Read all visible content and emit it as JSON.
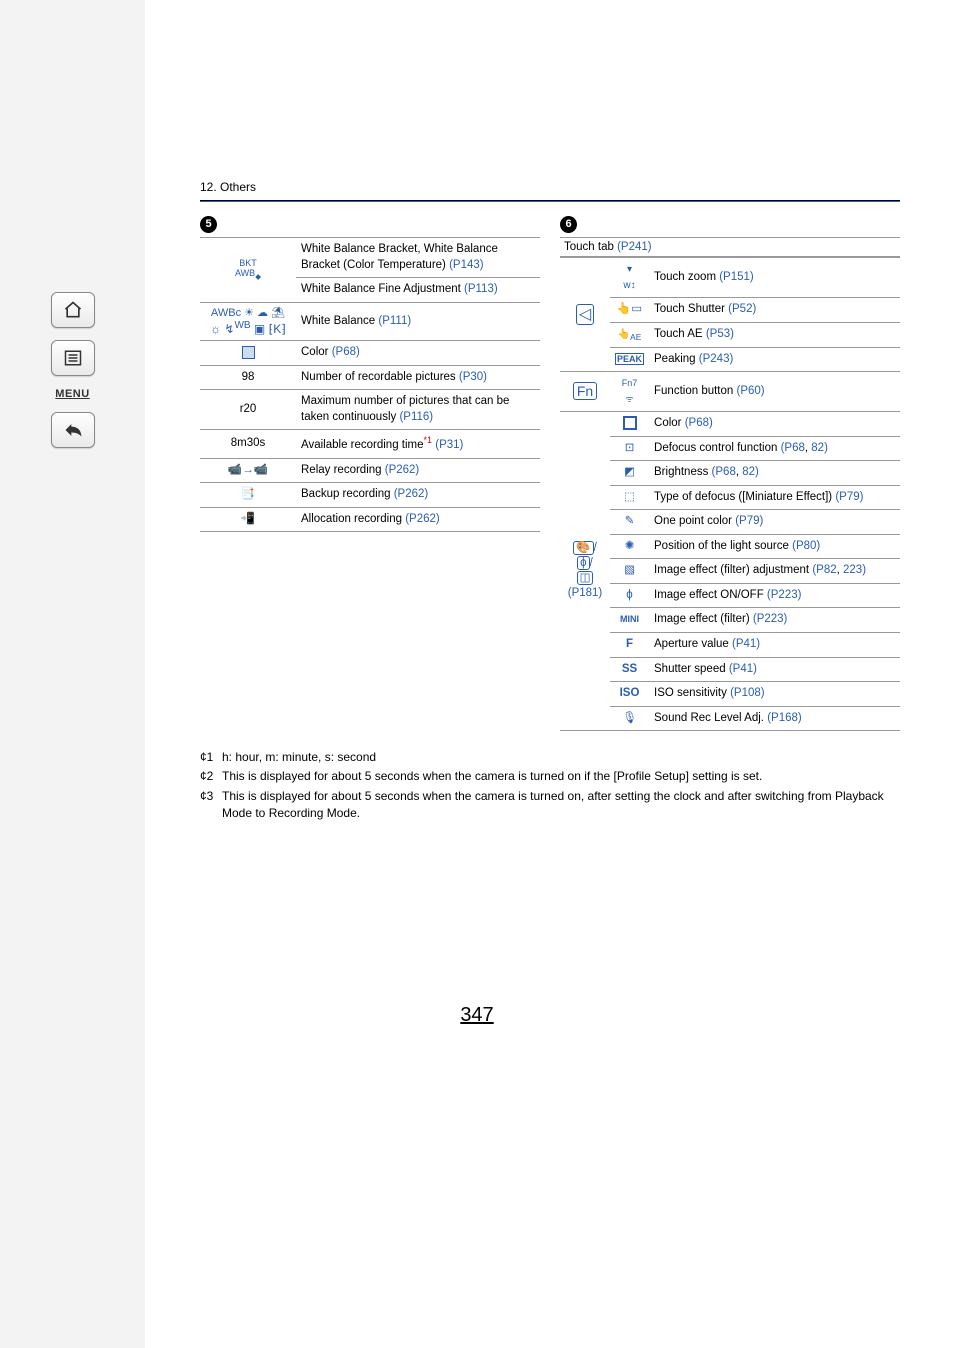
{
  "breadcrumb": "12. Others",
  "section5": {
    "badge": "5",
    "rows": [
      {
        "icon_html": "<div class='bkt'>BKT</div><div class='bkt'>AWB<sub>◆</sub></div>",
        "desc": "White Balance Bracket, White Balance Bracket (Color Temperature) ",
        "ref": "(P143)"
      },
      {
        "icon_html": "",
        "rowspan_from_prev": true,
        "desc": "White Balance Fine Adjustment ",
        "ref": "(P113)"
      },
      {
        "icon_html": "<div class='awb-line1'>AWBc ☼☁⛅</div><div class='awb-line2'>-☼- ‣<sup>WB</sup> ▣ ⁅K⁆</div>",
        "desc": "White Balance ",
        "ref": "(P111)"
      },
      {
        "icon_html": "<span class='square'></span>",
        "desc": "Color ",
        "ref": "(P68)"
      },
      {
        "icon_text": "98",
        "desc": "Number of recordable pictures ",
        "ref": "(P30)"
      },
      {
        "icon_text": "r20",
        "desc": "Maximum number of pictures that can be taken continuously ",
        "ref": "(P116)"
      },
      {
        "icon_text": "8m30s",
        "desc": "Available recording time",
        "sup": "*1",
        "ref": " (P31)"
      },
      {
        "icon_html": "<span class='iconrow'>📹 📹</span>",
        "desc": "Relay recording ",
        "ref": "(P262)"
      },
      {
        "icon_html": "<span style='color:#2a5db0'>📑</span>",
        "desc": "Backup recording ",
        "ref": "(P262)"
      },
      {
        "icon_html": "<span style='color:#2a5db0'>📲</span>",
        "desc": "Allocation recording ",
        "ref": "(P262)"
      }
    ]
  },
  "section6": {
    "badge": "6",
    "touch_tab_label": "Touch tab ",
    "touch_tab_ref": "(P241)",
    "p181_ref": "(P181)",
    "group1_icon": "◁",
    "group2_icon": "⟐",
    "group3_icons": "🎥/\n⏺/\n◫",
    "rows_g1": [
      {
        "icon": "⤢",
        "icon_name": "touch-zoom-icon",
        "desc": "Touch zoom ",
        "ref": "(P151)"
      },
      {
        "icon": "👆▭",
        "icon_name": "touch-shutter-icon",
        "desc": "Touch Shutter ",
        "ref": "(P52)"
      },
      {
        "icon": "👆AE",
        "icon_name": "touch-ae-icon",
        "desc": "Touch AE ",
        "ref": "(P53)"
      },
      {
        "icon": "PEAK",
        "icon_name": "peaking-icon",
        "desc": "Peaking ",
        "ref": "(P243)"
      }
    ],
    "rows_g2": [
      {
        "icon": "Fn7\nᯤ",
        "icon_name": "fn7-icon",
        "desc": "Function button ",
        "ref": "(P60)"
      }
    ],
    "rows_g3": [
      {
        "icon": "▣",
        "icon_name": "color-icon",
        "desc": "Color ",
        "ref": "(P68)"
      },
      {
        "icon": "⊡",
        "icon_name": "defocus-icon",
        "desc": "Defocus control function ",
        "ref": "(P68",
        "ref2": "82)"
      },
      {
        "icon": "⧉",
        "icon_name": "brightness-icon",
        "desc": "Brightness ",
        "ref": "(P68",
        "ref2": "82)"
      },
      {
        "icon": "⬚",
        "icon_name": "miniature-defocus-icon",
        "desc": "Type of defocus ([Miniature Effect]) ",
        "ref": "(P79)"
      },
      {
        "icon": "✎",
        "icon_name": "one-point-color-icon",
        "desc": "One point color ",
        "ref": "(P79)"
      },
      {
        "icon": "✺",
        "icon_name": "light-source-icon",
        "desc": "Position of the light source ",
        "ref": "(P80)"
      },
      {
        "icon": "▧",
        "icon_name": "filter-adjust-icon",
        "desc": "Image effect (filter) adjustment ",
        "ref": "(P82",
        "ref2": "223)"
      },
      {
        "icon": "ϕ",
        "icon_name": "effect-onoff-icon",
        "desc": "Image effect ON/OFF ",
        "ref": "(P223)"
      },
      {
        "icon": "MINI",
        "icon_name": "mini-icon",
        "is_mini": true,
        "desc": "Image effect (filter) ",
        "ref": "(P223)"
      },
      {
        "icon": "F",
        "icon_name": "aperture-icon",
        "desc": "Aperture value ",
        "ref": "(P41)"
      },
      {
        "icon": "SS",
        "icon_name": "shutter-speed-icon",
        "desc": "Shutter speed ",
        "ref": "(P41)"
      },
      {
        "icon": "ISO",
        "icon_name": "iso-icon",
        "desc": "ISO sensitivity ",
        "ref": "(P108)"
      },
      {
        "icon": "🎙",
        "icon_name": "mic-icon",
        "desc": "Sound Rec Level Adj. ",
        "ref": "(P168)"
      }
    ]
  },
  "notes": [
    {
      "marker": "¢1",
      "text": "h: hour, m: minute, s: second"
    },
    {
      "marker": "¢2",
      "text": "This is displayed for about 5 seconds when the camera is turned on if the [Profile Setup] setting is set."
    },
    {
      "marker": "¢3",
      "text": "This is displayed for about 5 seconds when the camera is turned on, after setting the clock and after switching from Playback Mode to Recording Mode."
    }
  ],
  "page_number": "347",
  "side_menu_label": "MENU"
}
